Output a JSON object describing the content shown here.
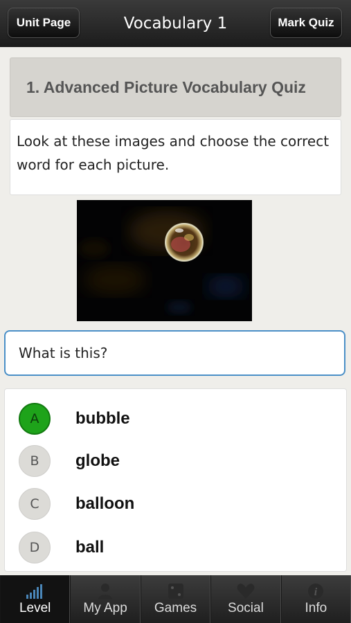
{
  "header": {
    "unit_page_label": "Unit Page",
    "title": "Vocabulary 1",
    "mark_quiz_label": "Mark Quiz"
  },
  "quiz": {
    "heading": "1.  Advanced Picture Vocabulary Quiz",
    "instructions": "Look at these images and choose the correct word for each picture.",
    "question": "What is this?",
    "answers": [
      {
        "letter": "A",
        "text": "bubble",
        "selected": true
      },
      {
        "letter": "B",
        "text": "globe",
        "selected": false
      },
      {
        "letter": "C",
        "text": "balloon",
        "selected": false
      },
      {
        "letter": "D",
        "text": "ball",
        "selected": false
      }
    ]
  },
  "tabs": [
    {
      "label": "Level",
      "icon": "signal-bars-icon",
      "active": true
    },
    {
      "label": "My App",
      "icon": "person-icon",
      "active": false
    },
    {
      "label": "Games",
      "icon": "dice-icon",
      "active": false
    },
    {
      "label": "Social",
      "icon": "heart-icon",
      "active": false
    },
    {
      "label": "Info",
      "icon": "info-icon",
      "active": false
    }
  ],
  "colors": {
    "selected_answer": "#1ea31a",
    "question_border": "#4a8fc7",
    "top_bar": "#1c1c1c"
  }
}
